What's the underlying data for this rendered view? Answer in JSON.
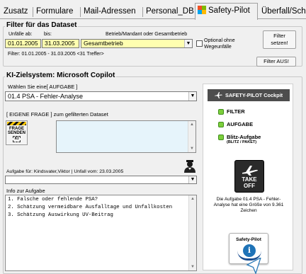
{
  "tabs": [
    {
      "label": "Zusatz",
      "active": false
    },
    {
      "label": "Formulare",
      "active": false
    },
    {
      "label": "Mail-Adressen",
      "active": false
    },
    {
      "label": "Personal_DB",
      "active": false
    },
    {
      "label": "Safety-Pilot",
      "active": true
    },
    {
      "label": "Überfall/Schock",
      "active": false
    }
  ],
  "filter": {
    "title": "Filter für das Dataset",
    "from_label": "Unfälle ab:",
    "to_label": "bis:",
    "mandant_label": "Betrieb/Mandant oder Gesamtbetrieb",
    "from_value": "01.01.2005",
    "to_value": "31.03.2005",
    "mandant_value": "Gesamtbetrieb",
    "optional_label": "Optional ohne Wegeunfälle",
    "set_button": "Filter setzen!",
    "off_button": "Filter AUS!",
    "summary": "Filter: 01.01.2005 - 31.03.2005 <31 Treffer>"
  },
  "ki": {
    "title": "KI-Zielsystem: Microsoft Copilot",
    "task_prompt": "Wählen Sie eine[ AUFGABE ]",
    "task_value": "01.4 PSA - Fehler-Analyse",
    "own_question_label": "[ EIGENE FRAGE ] zum gefilterten Dataset",
    "send_button_lines": [
      "FRAGE",
      "SENDEN"
    ],
    "send_button_ki": "KI",
    "assignment_label": "Aufgabe für: Kindsvater,Viktor | Unfall vom: 23.03.2005",
    "info_label": "Info zur Aufgabe",
    "info_lines": [
      "1. Falsche oder fehlende PSA?",
      "2. Schätzung vermeidbare Ausfalltage und Unfallkosten",
      "3. Schätzung Auswirkung UV-Beitrag"
    ]
  },
  "cockpit": {
    "title": "SAFETY-PILOT Cockpit",
    "status": [
      {
        "label": "FILTER",
        "sub": ""
      },
      {
        "label": "AUFGABE",
        "sub": ""
      },
      {
        "label": "Blitz-Aufgabe",
        "sub": "(BLITZ / PAKET)"
      }
    ],
    "takeoff_lines": [
      "TAKE",
      "OFF"
    ],
    "message": "Die Aufgabe 01.4 PSA - Fehler-Analyse hat eine Größe von 9.361 Zeichen",
    "sp_button": "Safety-Pilot",
    "sp_icon_glyph": "i"
  },
  "colors": {
    "field_yellow": "#ffffb0",
    "cockpit_header": "#4d4d4d",
    "led_green": "#7ccf3c",
    "info_blue": "#1f73b7",
    "question_box": "#e6f4fb"
  }
}
